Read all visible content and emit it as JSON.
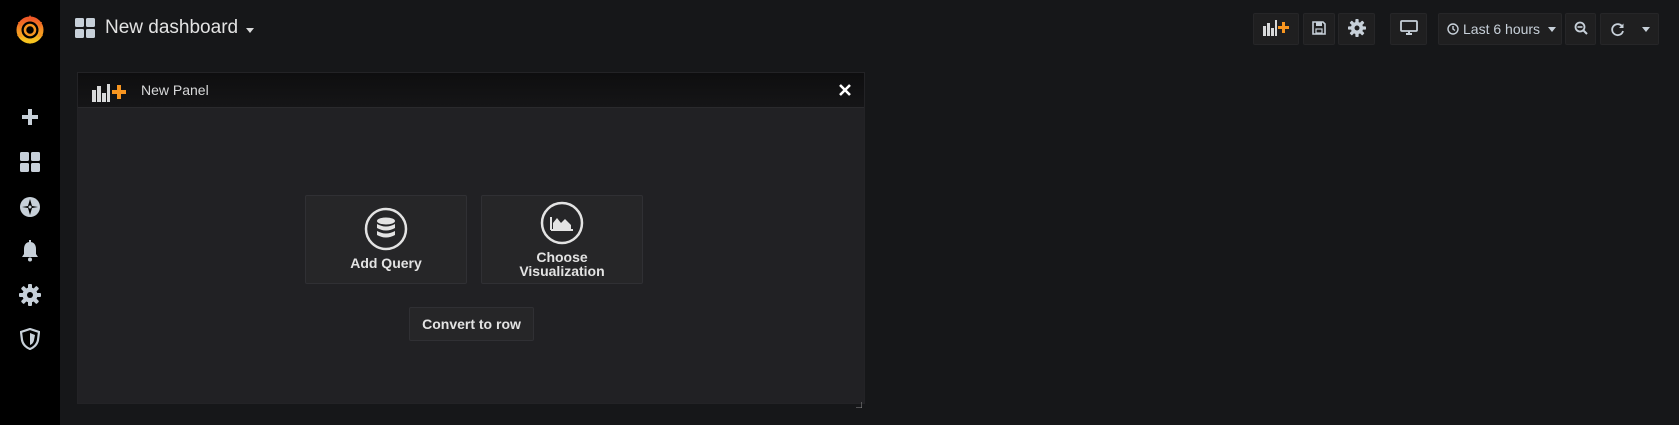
{
  "dashboard": {
    "title": "New dashboard"
  },
  "sidebar": {
    "items": [
      {
        "name": "create",
        "icon": "plus-icon"
      },
      {
        "name": "dashboards",
        "icon": "apps-icon"
      },
      {
        "name": "explore",
        "icon": "compass-icon"
      },
      {
        "name": "alerting",
        "icon": "bell-icon"
      },
      {
        "name": "configuration",
        "icon": "gear-icon"
      },
      {
        "name": "server-admin",
        "icon": "shield-icon"
      }
    ]
  },
  "toolbar": {
    "time_range_label": "Last 6 hours",
    "buttons": [
      "add-panel-icon",
      "save-icon",
      "gear-icon",
      "tv-icon",
      "clock-icon",
      "zoom-out-icon",
      "refresh-icon"
    ]
  },
  "panel": {
    "title": "New Panel",
    "add_query_label": "Add Query",
    "choose_viz_line1": "Choose",
    "choose_viz_line2": "Visualization",
    "convert_label": "Convert to row"
  },
  "colors": {
    "brand_orange": "#f79520",
    "brand_yellow": "#f7c41f",
    "background": "#161719",
    "panel_bg": "#212124",
    "sidebar_bg": "#000000"
  }
}
